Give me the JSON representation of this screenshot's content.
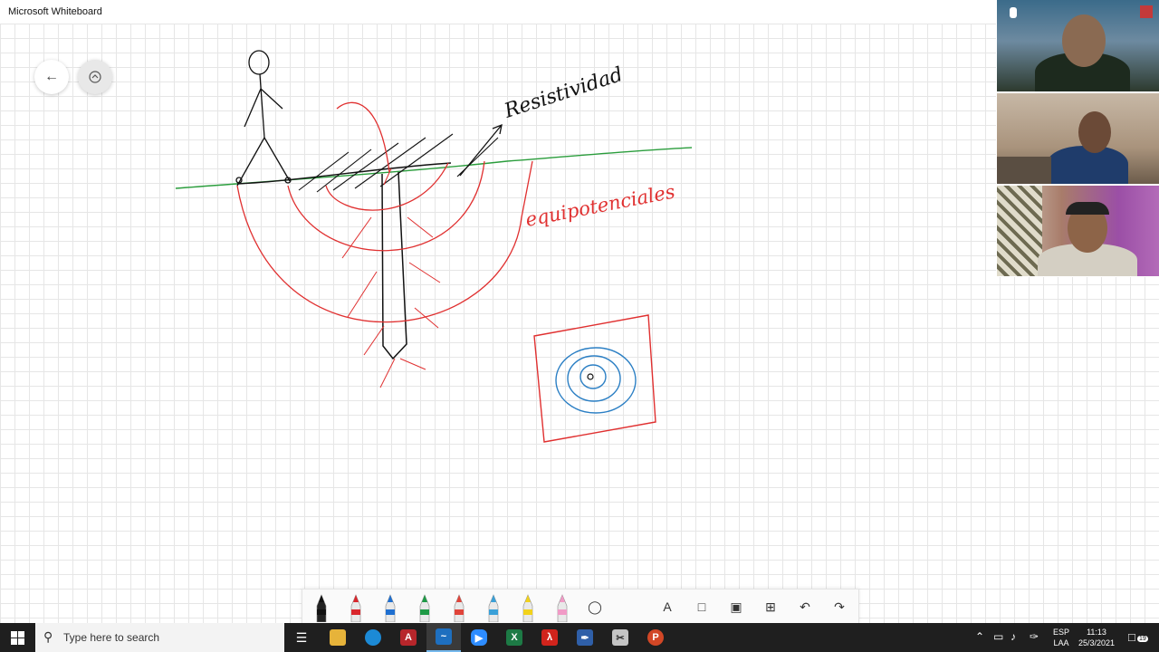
{
  "window": {
    "title": "Microsoft Whiteboard"
  },
  "canvas": {
    "annotations": {
      "resistivity": "Resistividad",
      "equipotentials": "equipotenciales"
    }
  },
  "nav": {
    "back_icon": "arrow-left-icon",
    "share_icon": "share-link-icon"
  },
  "video_tiles": [
    {
      "name": "participant-1"
    },
    {
      "name": "participant-2"
    },
    {
      "name": "participant-3"
    }
  ],
  "toolbar": {
    "tools": [
      {
        "name": "black-pen",
        "color": "#111111"
      },
      {
        "name": "red-pen",
        "color": "#d9262c"
      },
      {
        "name": "blue-pen",
        "color": "#1f6fd0"
      },
      {
        "name": "green-pen",
        "color": "#1e9a46"
      },
      {
        "name": "red-pen-2",
        "color": "#e0443a"
      },
      {
        "name": "cyan-pen",
        "color": "#3aa0d8"
      },
      {
        "name": "yellow-highlighter",
        "color": "#f2d21b"
      },
      {
        "name": "pink-eraser",
        "color": "#f19ac6"
      }
    ],
    "text_tool_glyph": "A",
    "undo_glyph": "↶",
    "redo_glyph": "↷"
  },
  "taskbar": {
    "search_placeholder": "Type here to search",
    "language": "ESP",
    "layout": "LAA",
    "time": "11:13",
    "date": "25/3/2021",
    "notifications": "19",
    "apps": [
      "task-view",
      "file-explorer",
      "edge",
      "access",
      "whiteboard",
      "zoom",
      "excel",
      "acrobat",
      "pen-app",
      "snipping",
      "powerpoint"
    ]
  },
  "colors": {
    "ground_line": "#2a9d3c",
    "equipotential": "#e03030",
    "sketch": "#111111",
    "contour": "#2b7fc4"
  }
}
